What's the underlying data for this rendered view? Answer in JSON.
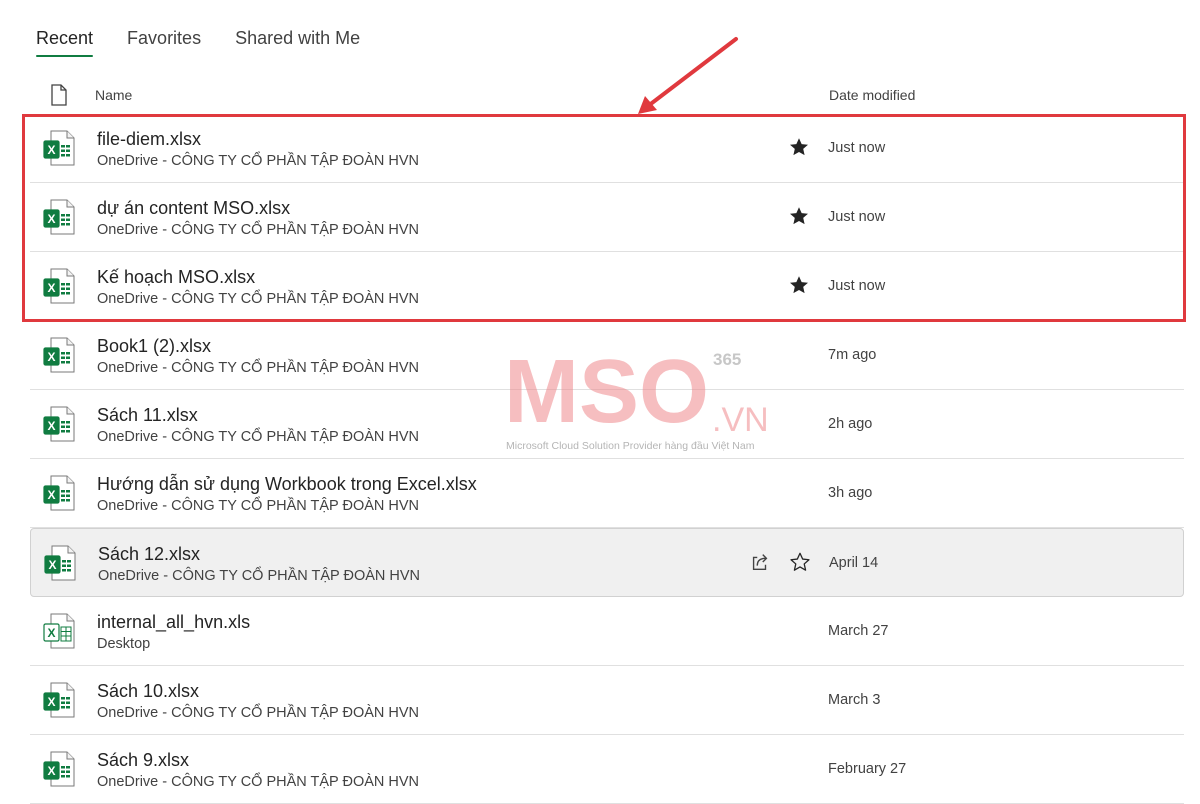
{
  "tabs": [
    "Recent",
    "Favorites",
    "Shared with Me"
  ],
  "header": {
    "name": "Name",
    "date_modified": "Date modified"
  },
  "files": [
    {
      "name": "file-diem.xlsx",
      "location": "OneDrive - CÔNG TY CỔ PHẦN TẬP ĐOÀN HVN",
      "date": "Just now",
      "favorite": true
    },
    {
      "name": "dự án content MSO.xlsx",
      "location": "OneDrive - CÔNG TY CỔ PHẦN TẬP ĐOÀN HVN",
      "date": "Just now",
      "favorite": true
    },
    {
      "name": "Kế hoạch MSO.xlsx",
      "location": "OneDrive - CÔNG TY CỔ PHẦN TẬP ĐOÀN HVN",
      "date": "Just now",
      "favorite": true
    },
    {
      "name": "Book1 (2).xlsx",
      "location": "OneDrive - CÔNG TY CỔ PHẦN TẬP ĐOÀN HVN",
      "date": "7m ago"
    },
    {
      "name": "Sách 11.xlsx",
      "location": "OneDrive - CÔNG TY CỔ PHẦN TẬP ĐOÀN HVN",
      "date": "2h ago"
    },
    {
      "name": "Hướng dẫn sử dụng Workbook trong Excel.xlsx",
      "location": "OneDrive - CÔNG TY CỔ PHẦN TẬP ĐOÀN HVN",
      "date": "3h ago"
    },
    {
      "name": "Sách 12.xlsx",
      "location": "OneDrive - CÔNG TY CỔ PHẦN TẬP ĐOÀN HVN",
      "date": "April 14",
      "hovered": true
    },
    {
      "name": "internal_all_hvn.xls",
      "location": "Desktop",
      "date": "March 27",
      "legacy": true
    },
    {
      "name": "Sách 10.xlsx",
      "location": "OneDrive - CÔNG TY CỔ PHẦN TẬP ĐOÀN HVN",
      "date": "March 3"
    },
    {
      "name": "Sách 9.xlsx",
      "location": "OneDrive - CÔNG TY CỔ PHẦN TẬP ĐOÀN HVN",
      "date": "February 27"
    }
  ],
  "watermark": {
    "logo": "MSO",
    "suffix": ".VN",
    "superscript": "365",
    "tagline": "Microsoft Cloud Solution Provider hàng đầu Việt Nam"
  },
  "colors": {
    "excel_green": "#107c41",
    "highlight_red": "#e0393e",
    "logo_pink": "#ef8a8e"
  },
  "icons": [
    "document-icon",
    "excel-file-icon",
    "star-filled-icon",
    "star-outline-icon",
    "share-icon",
    "annotation-arrow"
  ]
}
